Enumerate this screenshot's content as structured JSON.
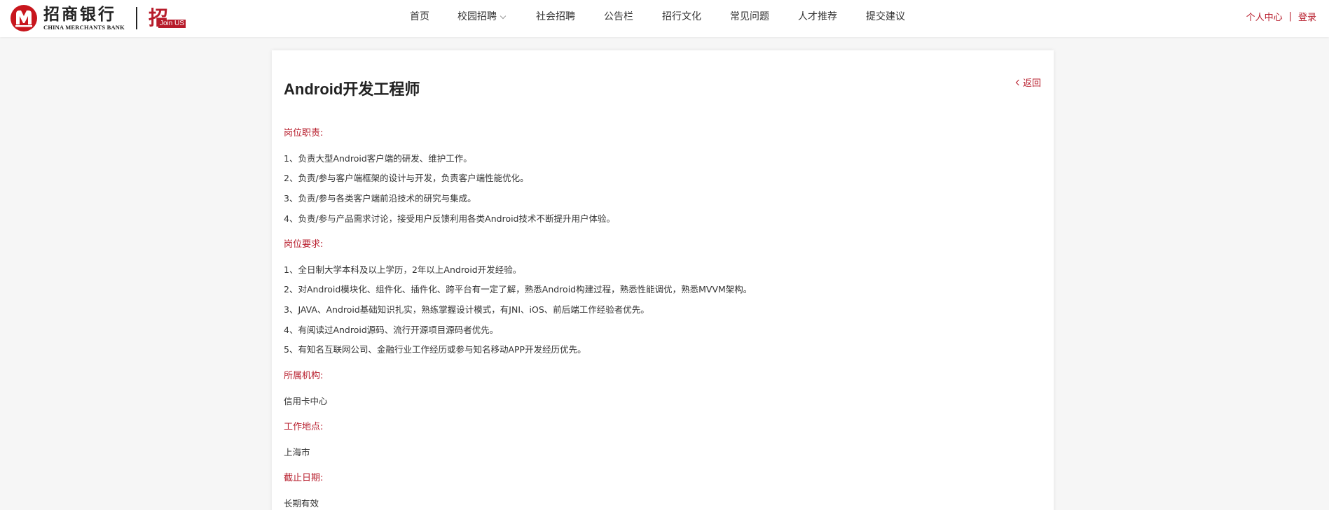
{
  "brand": {
    "name_cn": "招商银行",
    "name_en": "CHINA MERCHANTS BANK",
    "join_badge_main": "招",
    "join_badge_small": "Join US",
    "primary_color": "#b71c2b"
  },
  "nav": {
    "items": [
      {
        "label": "首页"
      },
      {
        "label": "校园招聘",
        "has_dropdown": true
      },
      {
        "label": "社会招聘"
      },
      {
        "label": "公告栏"
      },
      {
        "label": "招行文化"
      },
      {
        "label": "常见问题"
      },
      {
        "label": "人才推荐"
      },
      {
        "label": "提交建议"
      }
    ]
  },
  "user": {
    "personal_center": "个人中心",
    "separator": "|",
    "login": "登录"
  },
  "job": {
    "title": "Android开发工程师",
    "back_label": "返回",
    "sections": [
      {
        "title": "岗位职责:",
        "lines": [
          "1、负责大型Android客户端的研发、维护工作。",
          "2、负责/参与客户端框架的设计与开发，负责客户端性能优化。",
          "3、负责/参与各类客户端前沿技术的研究与集成。",
          "4、负责/参与产品需求讨论，接受用户反馈利用各类Android技术不断提升用户体验。"
        ]
      },
      {
        "title": "岗位要求:",
        "lines": [
          "1、全日制大学本科及以上学历，2年以上Android开发经验。",
          "2、对Android模块化、组件化、插件化、跨平台有一定了解，熟悉Android构建过程，熟悉性能调优，熟悉MVVM架构。",
          "3、JAVA、Android基础知识扎实，熟练掌握设计模式，有JNI、iOS、前后端工作经验者优先。",
          "4、有阅读过Android源码、流行开源项目源码者优先。",
          "5、有知名互联网公司、金融行业工作经历或参与知名移动APP开发经历优先。"
        ]
      },
      {
        "title": "所属机构:",
        "lines": [
          "信用卡中心"
        ]
      },
      {
        "title": "工作地点:",
        "lines": [
          "上海市"
        ]
      },
      {
        "title": "截止日期:",
        "lines": [
          "长期有效"
        ]
      }
    ]
  }
}
